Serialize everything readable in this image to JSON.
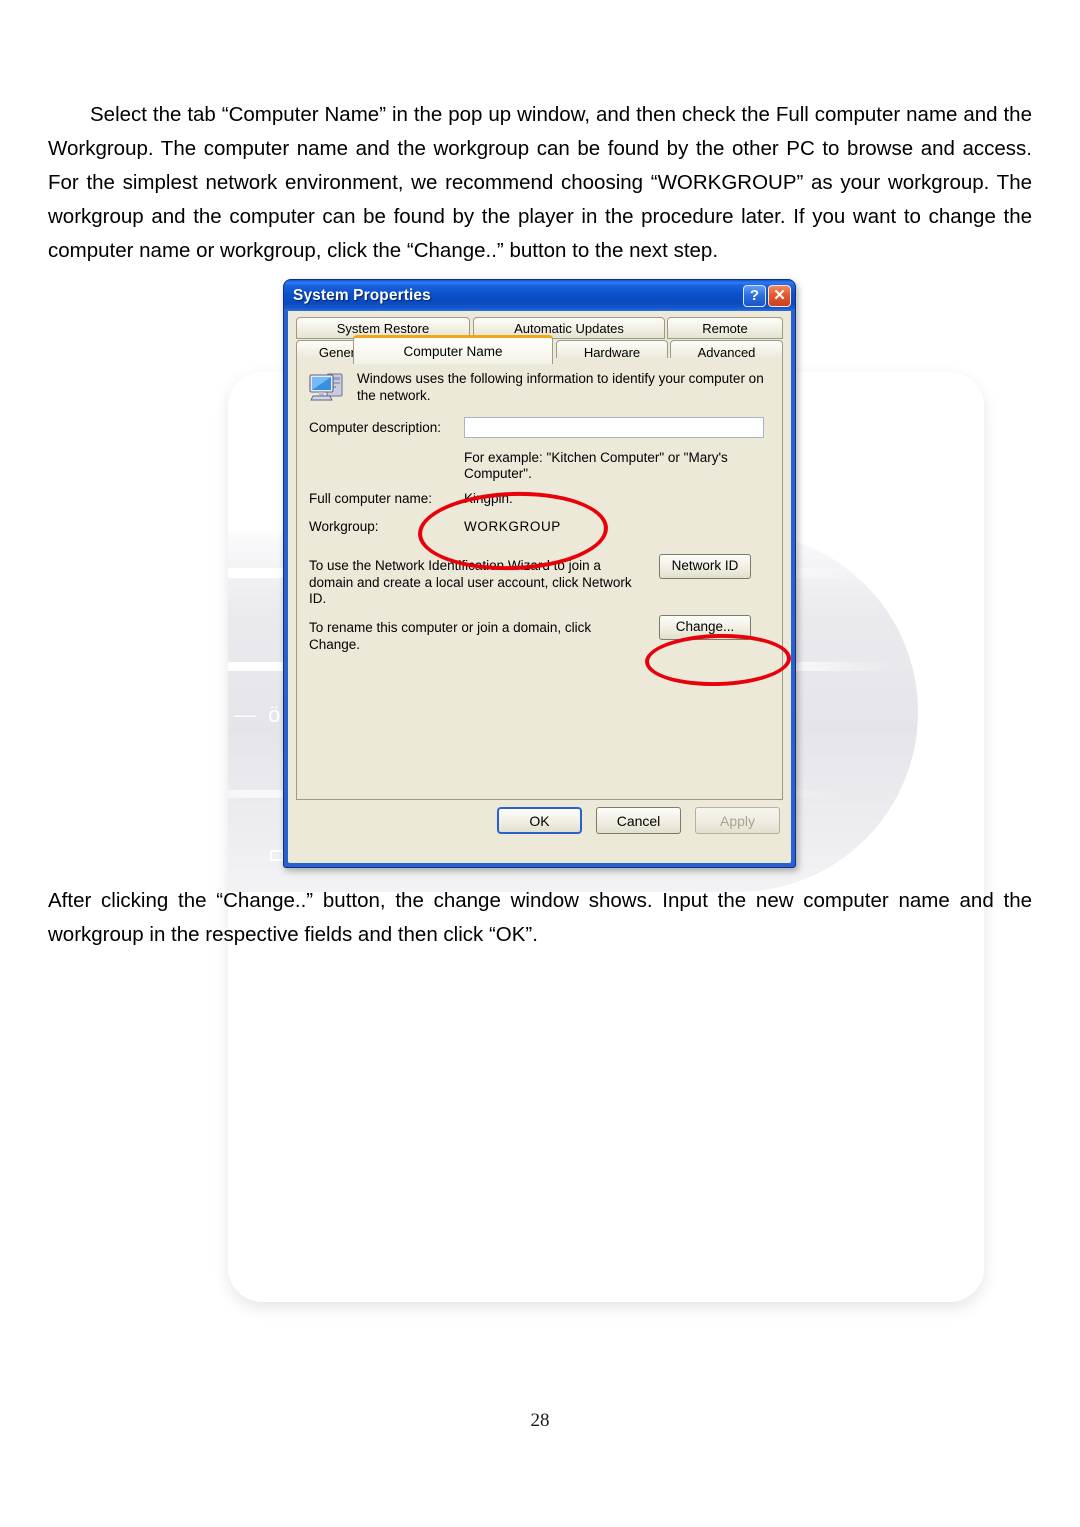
{
  "document": {
    "paragraph_top": "Select the tab “Computer Name” in the pop up window, and then check the Full computer name and the Workgroup. The computer name and the workgroup can be found by the other PC to browse and access. For the simplest network environment, we recommend choosing “WORKGROUP” as your workgroup. The workgroup and the computer can be found by the player in the procedure later. If you want to change the computer name or workgroup, click the “Change..” button to the next step.",
    "paragraph_bottom": "After clicking the “Change..” button, the change window shows. Input the new computer name and the workgroup in the respective fields and then click “OK”.",
    "page_number": "28"
  },
  "dialog": {
    "title": "System Properties",
    "titlebar_buttons": {
      "help": "?",
      "close": "✕"
    },
    "tabs_row1": [
      {
        "label": "System Restore",
        "active": false
      },
      {
        "label": "Automatic Updates",
        "active": false
      },
      {
        "label": "Remote",
        "active": false
      }
    ],
    "tabs_row2": [
      {
        "label": "General",
        "active": false
      },
      {
        "label": "Computer Name",
        "active": true
      },
      {
        "label": "Hardware",
        "active": false
      },
      {
        "label": "Advanced",
        "active": false
      }
    ],
    "computer_name_tab": {
      "intro_text": "Windows uses the following information to identify your computer on the network.",
      "computer_description_label": "Computer description:",
      "computer_description_value": "",
      "computer_description_placeholder": "",
      "example_hint": "For example: \"Kitchen Computer\" or \"Mary's Computer\".",
      "full_computer_name_label": "Full computer name:",
      "full_computer_name_value": "Kingpin.",
      "workgroup_label": "Workgroup:",
      "workgroup_value": "WORKGROUP",
      "network_id_text": "To use the Network Identification Wizard to join a domain and create a local user account, click Network ID.",
      "network_id_button": "Network ID",
      "change_text": "To rename this computer or join a domain, click Change.",
      "change_button": "Change..."
    },
    "footer": {
      "ok": "OK",
      "cancel": "Cancel",
      "apply": "Apply"
    }
  },
  "annotations": {
    "color": "#e8000b",
    "ellipse_names_target": "Kingpin. / WORKGROUP",
    "ellipse_change_target": "Change..."
  },
  "theme": {
    "titlebar_blue": "#0a49bf",
    "dialog_face": "#ece9d8",
    "active_tab_accent": "#f0a815",
    "ok_focus_border": "#2a61d0"
  }
}
